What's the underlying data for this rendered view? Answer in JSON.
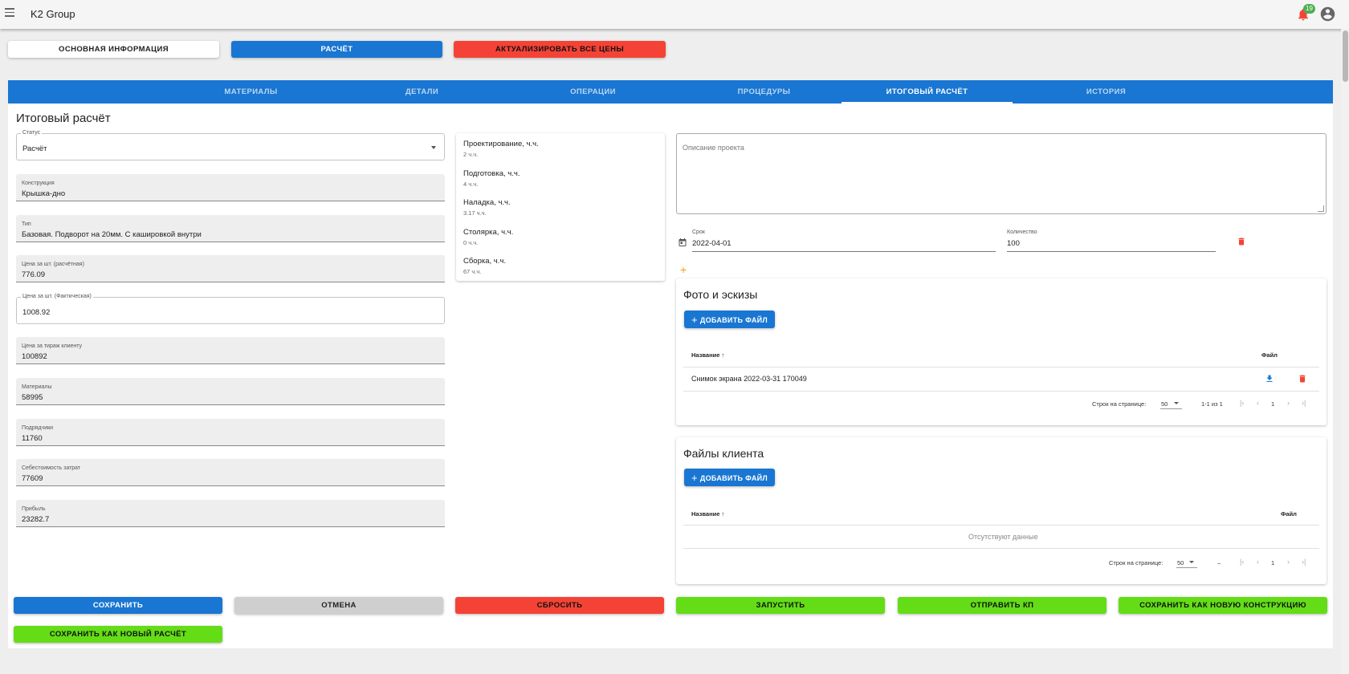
{
  "app": {
    "title": "K2 Group",
    "notifications": "19"
  },
  "top_buttons": {
    "info": "ОСНОВНАЯ ИНФОРМАЦИЯ",
    "calc": "РАСЧЁТ",
    "update_prices": "АКТУАЛИЗИРОВАТЬ ВСЕ ЦЕНЫ"
  },
  "tabs": [
    "МАТЕРИАЛЫ",
    "ДЕТАЛИ",
    "ОПЕРАЦИИ",
    "ПРОЦЕДУРЫ",
    "ИТОГОВЫЙ РАСЧЁТ",
    "ИСТОРИЯ"
  ],
  "active_tab": "ИТОГОВЫЙ РАСЧЁТ",
  "section_title": "Итоговый расчёт",
  "fields": {
    "status": {
      "label": "Статус",
      "value": "Расчёт"
    },
    "construction": {
      "label": "Конструкция",
      "value": "Крышка-дно"
    },
    "type": {
      "label": "Тип",
      "value": "Базовая. Подворот на 20мм. С каширoвкой внутри"
    },
    "price_calc": {
      "label": "Цена за шт. (расчётная)",
      "value": "776.09"
    },
    "price_actual": {
      "label": "Цена за шт. (Фактическая)",
      "value": "1008.92"
    },
    "price_run": {
      "label": "Цена за тираж клиенту",
      "value": "100892"
    },
    "materials": {
      "label": "Материалы",
      "value": "58995"
    },
    "contractors": {
      "label": "Подрядчики",
      "value": "11760"
    },
    "cost": {
      "label": "Себестоимость затрат",
      "value": "77609"
    },
    "profit": {
      "label": "Прибыль",
      "value": "23282.7"
    }
  },
  "hours": [
    {
      "name": "Проектирование, ч.ч.",
      "value": "2 ч.ч."
    },
    {
      "name": "Подготовка, ч.ч.",
      "value": "4 ч.ч."
    },
    {
      "name": "Наладка, ч.ч.",
      "value": "3.17 ч.ч."
    },
    {
      "name": "Столярка, ч.ч.",
      "value": "0 ч.ч."
    },
    {
      "name": "Сборка, ч.ч.",
      "value": "67 ч.ч."
    }
  ],
  "description": {
    "placeholder": "Описание проекта"
  },
  "deadline": {
    "label": "Срок",
    "value": "2022-04-01"
  },
  "quantity": {
    "label": "Количество",
    "value": "100"
  },
  "photos": {
    "title": "Фото и эскизы",
    "add_label": "ДОБАВИТЬ ФАЙЛ",
    "col_name": "Название",
    "col_file": "Файл",
    "rows": [
      {
        "name": "Снимок экрана 2022-03-31 170049"
      }
    ],
    "rows_per_page_label": "Строк на странице:",
    "rows_per_page": "50",
    "range": "1-1 из 1",
    "page": "1"
  },
  "client_files": {
    "title": "Файлы клиента",
    "add_label": "ДОБАВИТЬ ФАЙЛ",
    "col_name": "Название",
    "col_file": "Файл",
    "empty": "Отсутствуют данные",
    "rows_per_page_label": "Строк на странице:",
    "rows_per_page": "50",
    "range": "–",
    "page": "1"
  },
  "actions": {
    "save": "СОХРАНИТЬ",
    "cancel": "ОТМЕНА",
    "reset": "СБРОСИТЬ",
    "run": "ЗАПУСТИТЬ",
    "send_kp": "ОТПРАВИТЬ КП",
    "save_new_construction": "СОХРАНИТЬ КАК НОВУЮ КОНСТРУКЦИЮ",
    "save_new_calc": "СОХРАНИТЬ КАК НОВЫЙ РАСЧЁТ"
  },
  "colors": {
    "primary": "#1976d2",
    "danger": "#f44336",
    "success": "#64dd17",
    "neutral": "#cfcfcf",
    "badge": "#4caf50"
  }
}
